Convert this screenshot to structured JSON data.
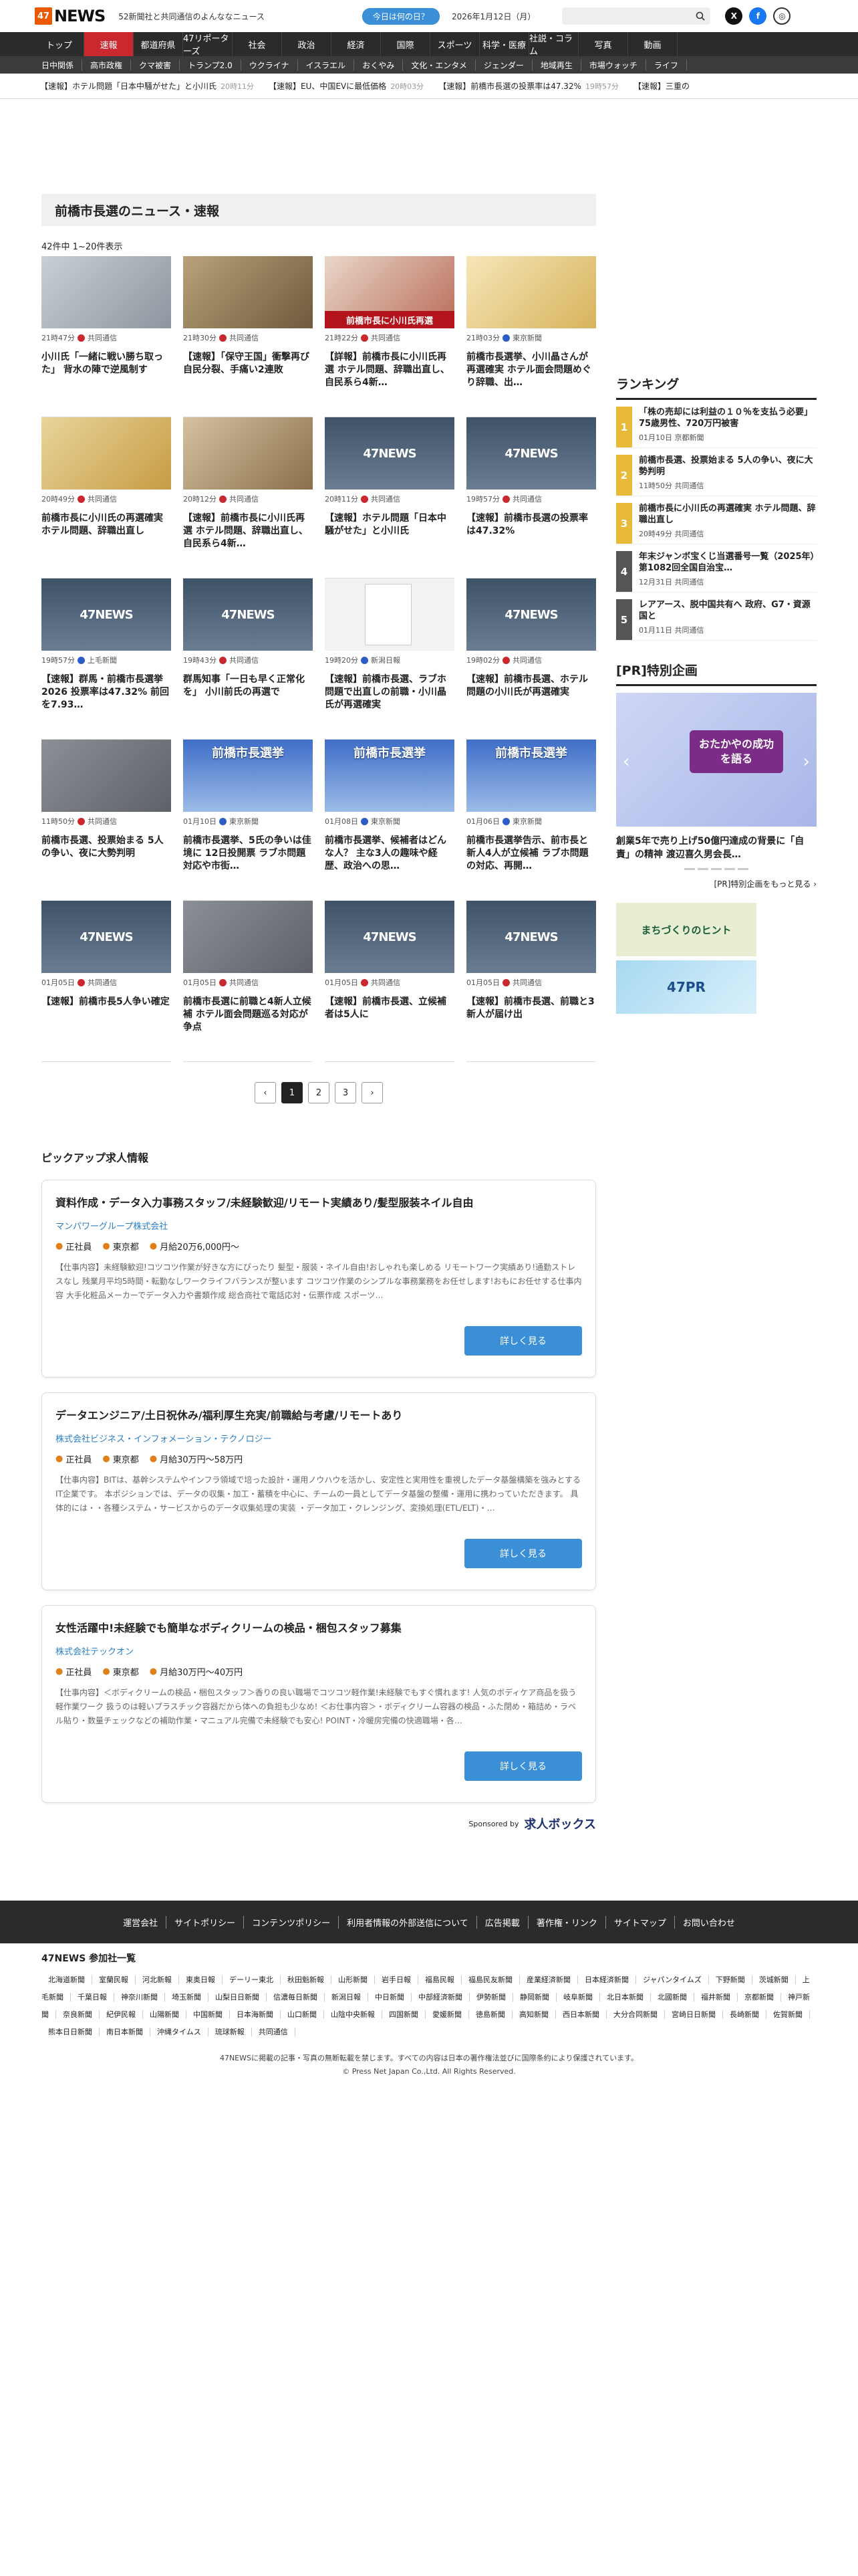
{
  "header": {
    "logo_mark": "47",
    "logo_word": "NEWS",
    "tagline": "52新聞社と共同通信のよんななニュース",
    "today_label": "今日は何の日？",
    "date": "2026年1月12日（月）",
    "icons": [
      "search-icon",
      "x-icon",
      "facebook-icon",
      "globe-icon"
    ]
  },
  "nav_main": [
    "トップ",
    "速報",
    "都道府県",
    "47リポーターズ",
    "社会",
    "政治",
    "経済",
    "国際",
    "スポーツ",
    "科学・医療",
    "社説・コラム",
    "写真",
    "動画"
  ],
  "nav_sub": [
    "日中関係",
    "高市政権",
    "クマ被害",
    "トランプ2.0",
    "ウクライナ",
    "イスラエル",
    "おくやみ",
    "文化・エンタメ",
    "ジェンダー",
    "地域再生",
    "市場ウォッチ",
    "ライフ"
  ],
  "ticker": [
    {
      "text": "【速報】ホテル問題「日本中騒がせた」と小川氏",
      "time": "20時11分"
    },
    {
      "text": "【速報】EU、中国EVに最低価格",
      "time": "20時03分"
    },
    {
      "text": "【速報】前橋市長選の投票率は47.32%",
      "time": "19時57分"
    },
    {
      "text": "【速報】三重の",
      "time": ""
    }
  ],
  "section": {
    "title": "前橋市長選のニュース・速報",
    "count": "42件中 1~20件表示"
  },
  "articles": [
    {
      "time": "21時47分",
      "src": "共同通信",
      "title": "小川氏「一緒に戦い勝ち取った」 背水の陣で逆風制す",
      "thumb": "t-p1",
      "red": ""
    },
    {
      "time": "21時30分",
      "src": "共同通信",
      "title": "【速報】「保守王国」衝撃再び 自民分裂、手痛い2連敗",
      "thumb": "t-p2",
      "red": ""
    },
    {
      "time": "21時22分",
      "src": "共同通信",
      "title": "【詳報】前橋市長に小川氏再選 ホテル問題、辞職出直し、自民系ら4新…",
      "thumb": "t-p3",
      "red": "前橋市長に小川氏再選"
    },
    {
      "time": "21時03分",
      "src": "東京新聞",
      "title": "前橋市長選挙、小川晶さんが再選確実 ホテル面会問題めぐり辞職、出…",
      "thumb": "t-p4",
      "red": ""
    },
    {
      "time": "20時49分",
      "src": "共同通信",
      "title": "前橋市長に小川氏の再選確実 ホテル問題、辞職出直し",
      "thumb": "t-p5",
      "red": ""
    },
    {
      "time": "20時12分",
      "src": "共同通信",
      "title": "【速報】前橋市長に小川氏再選 ホテル問題、辞職出直し、自民系ら4新…",
      "thumb": "t-p6",
      "red": ""
    },
    {
      "time": "20時11分",
      "src": "共同通信",
      "title": "【速報】ホテル問題「日本中騒がせた」と小川氏",
      "thumb": "t-news",
      "red": ""
    },
    {
      "time": "19時57分",
      "src": "共同通信",
      "title": "【速報】前橋市長選の投票率は47.32%",
      "thumb": "t-news",
      "red": ""
    },
    {
      "time": "19時57分",
      "src": "上毛新聞",
      "title": "【速報】群馬・前橋市長選挙2026 投票率は47.32% 前回を7.93…",
      "thumb": "t-news",
      "red": ""
    },
    {
      "time": "19時43分",
      "src": "共同通信",
      "title": "群馬知事「一日も早く正常化を」 小川前氏の再選で",
      "thumb": "t-news",
      "red": ""
    },
    {
      "time": "19時20分",
      "src": "新潟日報",
      "title": "【速報】前橋市長選、ラブホ問題で出直しの前職・小川晶氏が再選確実",
      "thumb": "t-doc",
      "red": ""
    },
    {
      "time": "19時02分",
      "src": "共同通信",
      "title": "【速報】前橋市長選、ホテル問題の小川氏が再選確実",
      "thumb": "t-news",
      "red": ""
    },
    {
      "time": "11時50分",
      "src": "共同通信",
      "title": "前橋市長選、投票始まる 5人の争い、夜に大勢判明",
      "thumb": "t-bld",
      "red": ""
    },
    {
      "time": "01月10日",
      "src": "東京新聞",
      "title": "前橋市長選挙、5氏の争いは佳境に 12日投開票 ラブホ問題対応や市街…",
      "thumb": "t-elec",
      "red": "",
      "elec": "前橋市長選挙"
    },
    {
      "time": "01月08日",
      "src": "東京新聞",
      "title": "前橋市長選挙、候補者はどんな人？ 主な3人の趣味や経歴、政治への思…",
      "thumb": "t-elec",
      "red": "",
      "elec": "前橋市長選挙"
    },
    {
      "time": "01月06日",
      "src": "東京新聞",
      "title": "前橋市長選挙告示、前市長と新人4人が立候補 ラブホ問題の対応、再開…",
      "thumb": "t-elec",
      "red": "",
      "elec": "前橋市長選挙"
    },
    {
      "time": "01月05日",
      "src": "共同通信",
      "title": "【速報】前橋市長5人争い確定",
      "thumb": "t-news",
      "red": ""
    },
    {
      "time": "01月05日",
      "src": "共同通信",
      "title": "前橋市長選に前職と4新人立候補 ホテル面会問題巡る対応が争点",
      "thumb": "t-bld",
      "red": ""
    },
    {
      "time": "01月05日",
      "src": "共同通信",
      "title": "【速報】前橋市長選、立候補者は5人に",
      "thumb": "t-news",
      "red": ""
    },
    {
      "time": "01月05日",
      "src": "共同通信",
      "title": "【速報】前橋市長選、前職と3新人が届け出",
      "thumb": "t-news",
      "red": ""
    }
  ],
  "thumb_word": "47NEWS",
  "pager": [
    "1",
    "2",
    "3"
  ],
  "ranking": {
    "title": "ランキング",
    "items": [
      {
        "n": "1",
        "title": "「株の売却には利益の１０％を支払う必要」75歳男性、720万円被害",
        "meta": "01月10日",
        "src": "京都新聞"
      },
      {
        "n": "2",
        "title": "前橋市長選、投票始まる 5人の争い、夜に大勢判明",
        "meta": "11時50分",
        "src": "共同通信"
      },
      {
        "n": "3",
        "title": "前橋市長に小川氏の再選確実 ホテル問題、辞職出直し",
        "meta": "20時49分",
        "src": "共同通信"
      },
      {
        "n": "4",
        "title": "年末ジャンボ宝くじ当選番号一覧（2025年）第1082回全国自治宝…",
        "meta": "12月31日",
        "src": "共同通信"
      },
      {
        "n": "5",
        "title": "レアアース、脱中国共有へ 政府、G7・資源国と",
        "meta": "01月11日",
        "src": "共同通信"
      }
    ]
  },
  "pr": {
    "title": "[PR]特別企画",
    "banner": "おたかやの成功を語る",
    "caption": "創業5年で売り上げ50億円達成の背景に「自責」の精神 渡辺喜久男会長…",
    "more": "[PR]特別企画をもっと見る ›",
    "banner1": "まちづくりのヒント",
    "banner2": "47PR"
  },
  "jobs": {
    "title": "ピックアップ求人情報",
    "items": [
      {
        "title": "資料作成・データ入力事務スタッフ/未経験歓迎/リモート実績あり/髪型服装ネイル自由",
        "company": "マンパワーグループ株式会社",
        "type": "正社員",
        "place": "東京都",
        "pay": "月給20万6,000円～",
        "desc": "【仕事内容】未経験歓迎!コツコツ作業が好きな方にぴったり 髪型・服装・ネイル自由!おしゃれも楽しめる リモートワーク実績あり!通勤ストレスなし 残業月平均5時間・転勤なしワークライフバランスが整います コツコツ作業のシンプルな事務業務をお任せします!おもにお任せする仕事内容 大手化粧品メーカーでデータ入力や書類作成 総合商社で電話応対・伝票作成 スポーツ…",
        "btn": "詳しく見る"
      },
      {
        "title": "データエンジニア/土日祝休み/福利厚生充実/前職給与考慮/リモートあり",
        "company": "株式会社ビジネス・インフォメーション・テクノロジー",
        "type": "正社員",
        "place": "東京都",
        "pay": "月給30万円～58万円",
        "desc": "【仕事内容】BITは、基幹システムやインフラ領域で培った設計・運用ノウハウを活かし、安定性と実用性を重視したデータ基盤構築を強みとする IT企業です。 本ポジションでは、データの収集・加工・蓄積を中心に、チームの一員としてデータ基盤の整備・運用に携わっていただきます。 具体的には・・各種システム・サービスからのデータ収集処理の実装 ・データ加工・クレンジング、変換処理(ETL/ELT)・…",
        "btn": "詳しく見る"
      },
      {
        "title": "女性活躍中!未経験でも簡単なボディクリームの検品・梱包スタッフ募集",
        "company": "株式会社テックオン",
        "type": "正社員",
        "place": "東京都",
        "pay": "月給30万円～40万円",
        "desc": "【仕事内容】＜ボディクリームの検品・梱包スタッフ＞香りの良い職場でコツコツ軽作業!未経験でもすぐ慣れます! 人気のボディケア商品を扱う軽作業ワーク 扱うのは軽いプラスチック容器だから体への負担も少なめ! ＜お仕事内容＞・ボディクリーム容器の検品・ふた閉め・箱詰め・ラベル貼り・数量チェックなどの補助作業・マニュアル完備で未経験でも安心! POINT・冷暖房完備の快適職場・各…",
        "btn": "詳しく見る"
      }
    ],
    "sponsor_label": "Sponsored by",
    "sponsor_name": "求人ボックス"
  },
  "footer": {
    "links": [
      "運営会社",
      "サイトポリシー",
      "コンテンツポリシー",
      "利用者情報の外部送信について",
      "広告掲載",
      "著作権・リンク",
      "サイトマップ",
      "お問い合わせ"
    ],
    "papers_title": "47NEWS 参加社一覧",
    "papers": [
      "北海道新聞",
      "室蘭民報",
      "河北新報",
      "東奥日報",
      "デーリー東北",
      "秋田魁新報",
      "山形新聞",
      "岩手日報",
      "福島民報",
      "福島民友新聞",
      "産業経済新聞",
      "日本経済新聞",
      "ジャパンタイムズ",
      "下野新聞",
      "茨城新聞",
      "上毛新聞",
      "千葉日報",
      "神奈川新聞",
      "埼玉新聞",
      "山梨日日新聞",
      "信濃毎日新聞",
      "新潟日報",
      "中日新聞",
      "中部経済新聞",
      "伊勢新聞",
      "静岡新聞",
      "岐阜新聞",
      "北日本新聞",
      "北國新聞",
      "福井新聞",
      "京都新聞",
      "神戸新聞",
      "奈良新聞",
      "紀伊民報",
      "山陽新聞",
      "中国新聞",
      "日本海新聞",
      "山口新聞",
      "山陰中央新報",
      "四国新聞",
      "愛媛新聞",
      "徳島新聞",
      "高知新聞",
      "西日本新聞",
      "大分合同新聞",
      "宮崎日日新聞",
      "長崎新聞",
      "佐賀新聞",
      "熊本日日新聞",
      "南日本新聞",
      "沖縄タイムス",
      "琉球新報",
      "共同通信"
    ],
    "copy1": "47NEWSに掲載の記事・写真の無断転載を禁じます。すべての内容は日本の著作権法並びに国際条約により保護されています。",
    "copy2": "© Press Net Japan Co.,Ltd. All Rights Reserved."
  }
}
